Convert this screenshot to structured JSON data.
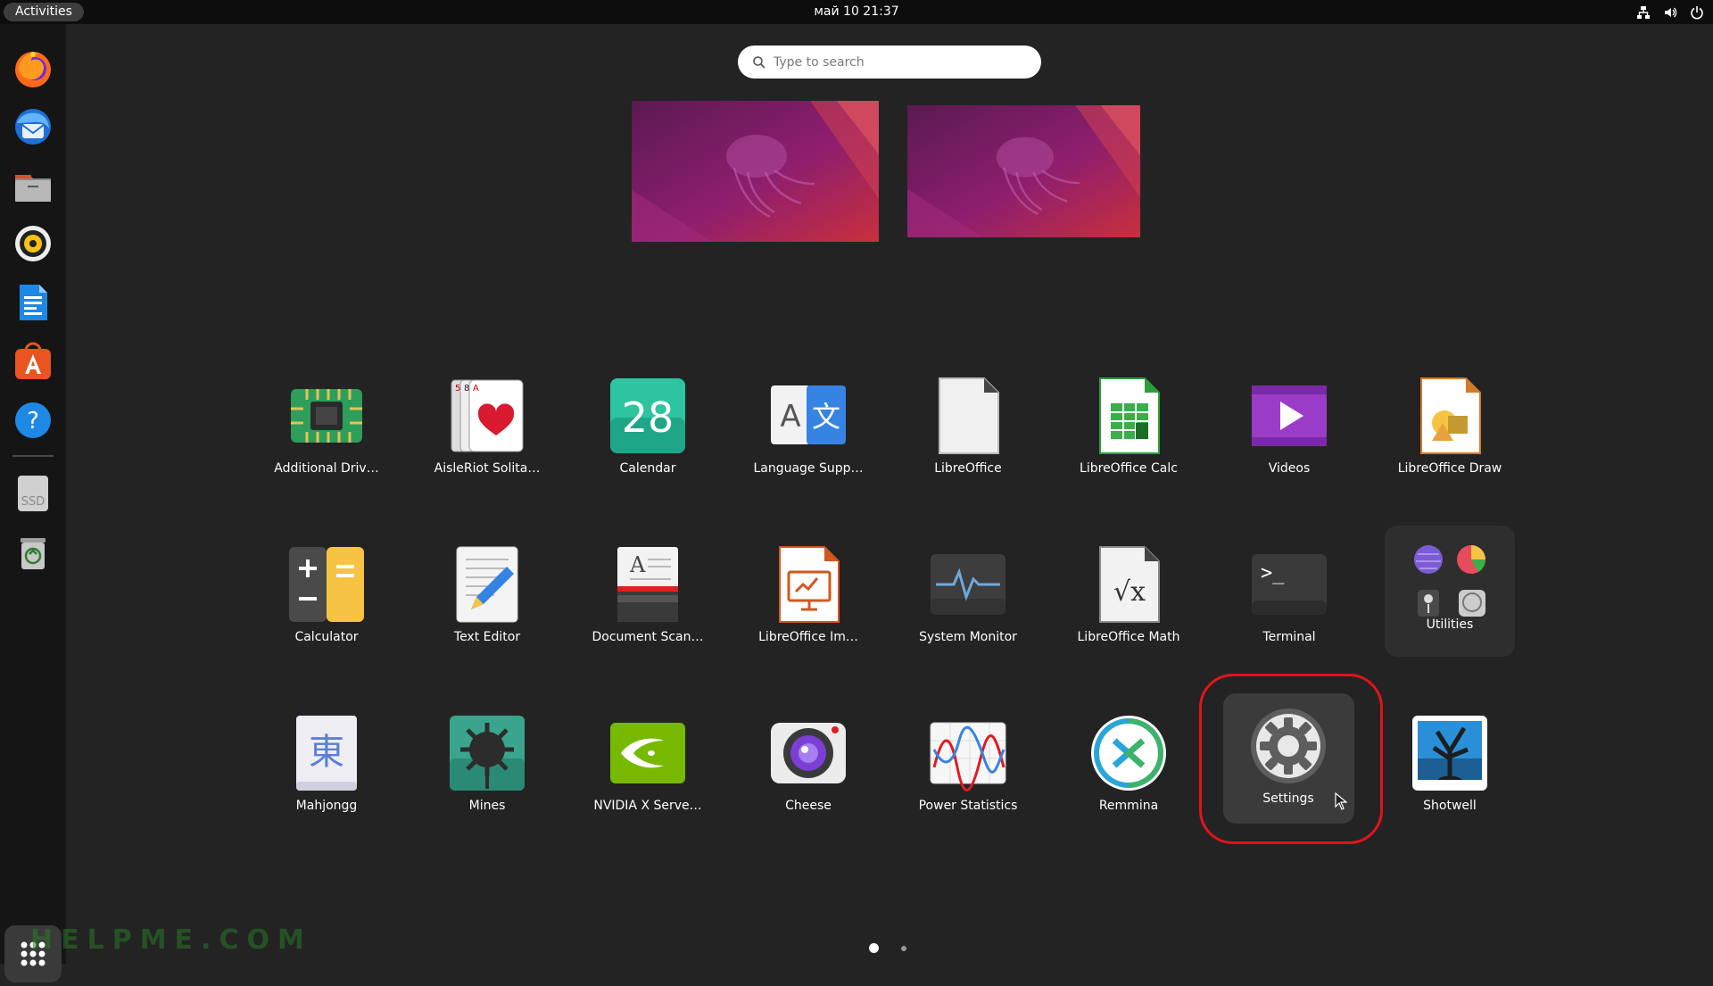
{
  "topbar": {
    "activities_label": "Activities",
    "clock": "май 10  21:37",
    "tray_icons": [
      "network-icon",
      "volume-icon",
      "power-icon"
    ]
  },
  "dock": {
    "items": [
      {
        "name": "Firefox",
        "icon": "firefox-icon"
      },
      {
        "name": "Thunderbird",
        "icon": "thunderbird-icon"
      },
      {
        "name": "Files",
        "icon": "files-icon"
      },
      {
        "name": "Rhythmbox",
        "icon": "rhythmbox-icon"
      },
      {
        "name": "LibreOffice Writer",
        "icon": "writer-icon"
      },
      {
        "name": "Ubuntu Software",
        "icon": "software-icon"
      },
      {
        "name": "Help",
        "icon": "help-icon"
      },
      {
        "name": "SSD",
        "icon": "ssd-drive-icon",
        "label": "SSD"
      },
      {
        "name": "Trash",
        "icon": "trash-icon"
      }
    ],
    "show_apps_icon": "app-grid-icon"
  },
  "watermark": "HELPME.COM",
  "search": {
    "placeholder": "Type to search"
  },
  "workspaces": [
    "workspace-1",
    "workspace-2"
  ],
  "apps": {
    "row1": [
      {
        "label": "Additional Driv…",
        "icon": "chip-icon"
      },
      {
        "label": "AisleRiot Solita…",
        "icon": "cards-icon"
      },
      {
        "label": "Calendar",
        "icon": "calendar-icon",
        "day": "28"
      },
      {
        "label": "Language Supp…",
        "icon": "language-icon",
        "glyph_a": "A",
        "glyph_b": "文"
      },
      {
        "label": "LibreOffice",
        "icon": "libreoffice-icon"
      },
      {
        "label": "LibreOffice Calc",
        "icon": "calc-icon"
      },
      {
        "label": "Videos",
        "icon": "videos-icon"
      },
      {
        "label": "LibreOffice Draw",
        "icon": "draw-icon"
      }
    ],
    "row2": [
      {
        "label": "Calculator",
        "icon": "calculator-icon"
      },
      {
        "label": "Text Editor",
        "icon": "text-editor-icon"
      },
      {
        "label": "Document Scan…",
        "icon": "scanner-icon",
        "glyph": "A"
      },
      {
        "label": "LibreOffice Im…",
        "icon": "impress-icon"
      },
      {
        "label": "System Monitor",
        "icon": "system-monitor-icon"
      },
      {
        "label": "LibreOffice Math",
        "icon": "math-icon",
        "glyph": "√x"
      },
      {
        "label": "Terminal",
        "icon": "terminal-icon",
        "glyph": ">_"
      },
      {
        "label": "Utilities",
        "icon": "folder-icon"
      }
    ],
    "row3": [
      {
        "label": "Mahjongg",
        "icon": "mahjongg-icon",
        "glyph": "東"
      },
      {
        "label": "Mines",
        "icon": "mines-icon"
      },
      {
        "label": "NVIDIA X Serve…",
        "icon": "nvidia-icon"
      },
      {
        "label": "Cheese",
        "icon": "cheese-icon"
      },
      {
        "label": "Power Statistics",
        "icon": "power-statistics-icon"
      },
      {
        "label": "Remmina",
        "icon": "remmina-icon"
      },
      {
        "label": "Settings",
        "icon": "settings-icon",
        "selected": true
      },
      {
        "label": "Shotwell",
        "icon": "shotwell-icon"
      }
    ]
  },
  "pagination": {
    "pages": 2,
    "current": 1
  }
}
